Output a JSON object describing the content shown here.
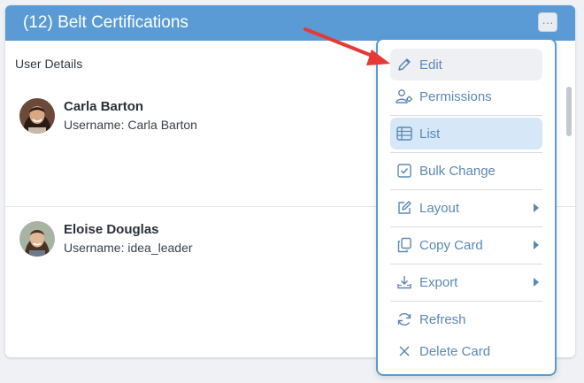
{
  "card": {
    "title": "(12) Belt Certifications",
    "more_label": "···",
    "section_label": "User Details"
  },
  "users": [
    {
      "name": "Carla Barton",
      "username": "Username: Carla Barton"
    },
    {
      "name": "Eloise Douglas",
      "username": "Username: idea_leader"
    }
  ],
  "menu": {
    "items": [
      {
        "label": "Edit",
        "icon": "pencil-icon"
      },
      {
        "label": "Permissions",
        "icon": "user-gear-icon"
      },
      {
        "label": "List",
        "icon": "table-icon"
      },
      {
        "label": "Bulk Change",
        "icon": "checkbox-icon"
      },
      {
        "label": "Layout",
        "icon": "edit-square-icon"
      },
      {
        "label": "Copy Card",
        "icon": "copy-icon"
      },
      {
        "label": "Export",
        "icon": "download-tray-icon"
      },
      {
        "label": "Refresh",
        "icon": "refresh-icon"
      },
      {
        "label": "Delete Card",
        "icon": "close-icon"
      }
    ],
    "hovered": "Edit",
    "selected": "List"
  },
  "colors": {
    "header": "#5b9bd5",
    "menu_text": "#5b88b5",
    "menu_border": "#5b9bd5",
    "selected_bg": "#d6e7f8",
    "arrow": "#e53935"
  }
}
